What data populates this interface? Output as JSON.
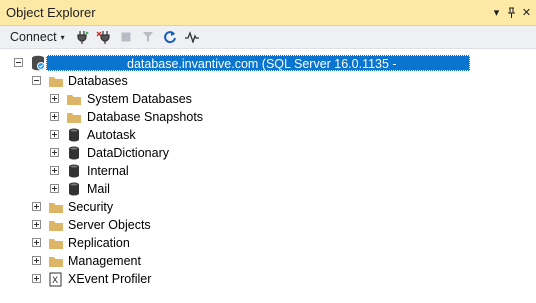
{
  "window": {
    "title": "Object Explorer",
    "controls": [
      "▾",
      "⊥",
      "✕"
    ]
  },
  "toolbar": {
    "connect_label": "Connect",
    "connect_caret": "▾",
    "buttons": [
      {
        "icon": "connect-plug-icon"
      },
      {
        "icon": "disconnect-plug-icon"
      },
      {
        "icon": "stop-icon"
      },
      {
        "icon": "filter-icon"
      },
      {
        "icon": "refresh-icon"
      },
      {
        "icon": "activity-monitor-icon"
      }
    ]
  },
  "tree": {
    "server": {
      "label": "database.invantive.com (SQL Server 16.0.1135 -",
      "label_suffix": ")"
    },
    "databases_label": "Databases",
    "databases": [
      {
        "label": "System Databases",
        "icon": "folder-icon"
      },
      {
        "label": "Database Snapshots",
        "icon": "folder-icon"
      },
      {
        "label": "Autotask",
        "icon": "database-icon"
      },
      {
        "label": "DataDictionary",
        "icon": "database-icon"
      },
      {
        "label": "Internal",
        "icon": "database-icon"
      },
      {
        "label": "Mail",
        "icon": "database-icon"
      }
    ],
    "top_folders": [
      {
        "label": "Security",
        "icon": "folder-icon"
      },
      {
        "label": "Server Objects",
        "icon": "folder-icon"
      },
      {
        "label": "Replication",
        "icon": "folder-icon"
      },
      {
        "label": "Management",
        "icon": "folder-icon"
      },
      {
        "label": "XEvent Profiler",
        "icon": "xevent-icon"
      }
    ]
  },
  "colors": {
    "title_bar": "#fde9a6",
    "selection": "#0a74d1",
    "folder": "#dcb567"
  }
}
